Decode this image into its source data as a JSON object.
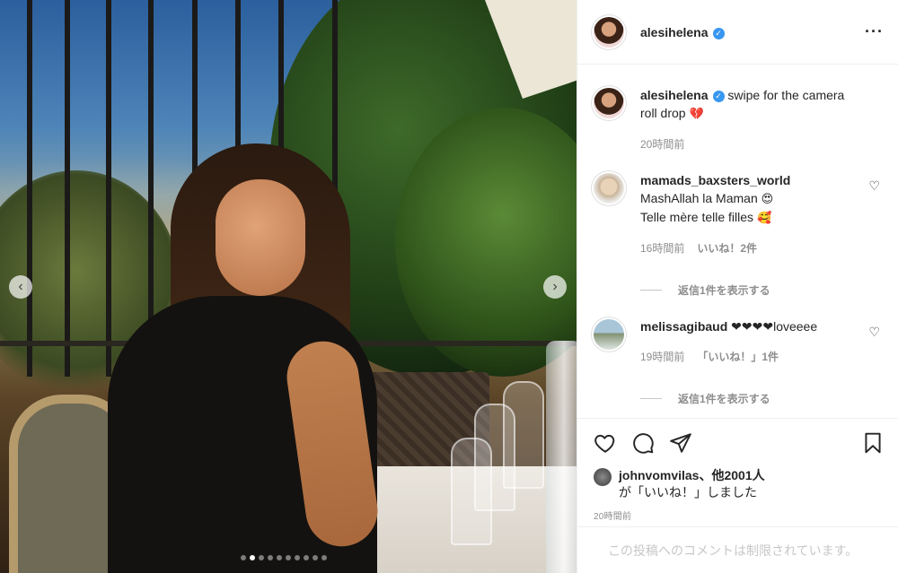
{
  "post": {
    "username": "alesihelena",
    "more_icon": "more-horizontal-icon"
  },
  "caption": {
    "username": "alesihelena",
    "text": "swipe for the camera roll drop",
    "emoji": "💔",
    "time": "20時間前"
  },
  "comments": [
    {
      "username": "mamads_baxsters_world",
      "line1": "MashAllah la Maman",
      "emoji1": "😍",
      "line2": "Telle mère telle filles",
      "emoji2": "🥰",
      "time": "16時間前",
      "likes": "いいね！2件",
      "replies": "返信1件を表示する"
    },
    {
      "username": "melissagibaud",
      "text": "❤❤❤❤loveeee",
      "time": "19時間前",
      "likes": "「いいね！」1件",
      "replies": "返信1件を表示する"
    }
  ],
  "likes_summary": {
    "user": "johnvomvilas",
    "others": "、他2001人",
    "suffix": "が「いいね！」しました"
  },
  "post_time": "20時間前",
  "footer": {
    "comments_restricted": "この投稿へのコメントは制限されています。"
  },
  "carousel": {
    "total_slides": 10,
    "active_slide": 2
  },
  "colors": {
    "verified": "#3897f0",
    "text": "#262626",
    "muted": "#8e8e8e"
  }
}
